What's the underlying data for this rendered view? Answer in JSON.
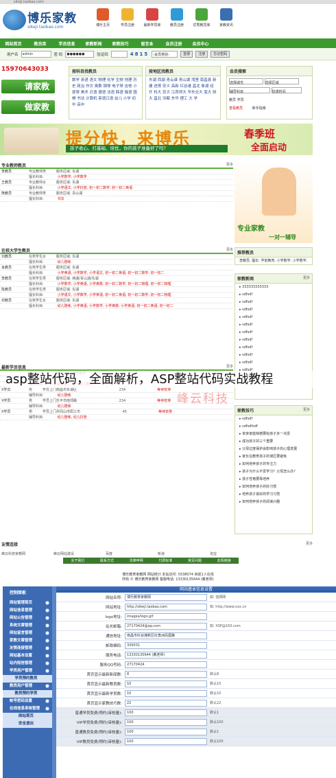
{
  "top_strip": "sikeji.taobao.com",
  "logo": {
    "name": "博乐家教",
    "url": "sikeji.taobao.com"
  },
  "top_nav": [
    {
      "label": "博乐主页",
      "color": "#e15a2a"
    },
    {
      "label": "学员注册",
      "color": "#f0b330"
    },
    {
      "label": "最新学员库",
      "color": "#d84444"
    },
    {
      "label": "教员注册",
      "color": "#2f9bd6"
    },
    {
      "label": "优秀教员库",
      "color": "#4aa63a"
    },
    {
      "label": "家教资讯",
      "color": "#3a6fb0"
    }
  ],
  "main_nav": [
    "网站首页",
    "教员库",
    "学员信息",
    "家教新闻",
    "家教技巧",
    "留言本",
    "会员注册",
    "会员中心"
  ],
  "login": {
    "user_label": "用户名",
    "user_value": "admin",
    "pwd_label": "密 码",
    "pwd_value": "●●●●●●",
    "code_label": "验证码",
    "code_value": "4815",
    "select_value": "-会员类别-",
    "login_btn": "登录",
    "reg_btn": "注册",
    "forgot_btn": "忘记密码"
  },
  "phone": "15970643033",
  "buttons": {
    "qing": "请家教",
    "zuo": "做家教"
  },
  "subject_box": {
    "title": "按科目找教员",
    "text": "数学 英语 语文 物理 化学 生物 地理 历史 政治 作文 奥数 钢琴 电子琴 吉他 小提琴 美术 日语 德语 法语 韩语 俄语 围棋 书法 计算机 英语口语 幼儿 小学 初中 高中"
  },
  "region_box": {
    "title": "按地区找教员",
    "text": "东湖 西湖 青云谱 青山湖 湾里 南昌县 新建 进贤 安义 高新 红谷滩 昌北 象湖 经开 科大 农大 江西师大 华东交大 南大 财大 昌北 洪都 东华 理工 大 学"
  },
  "member_box": {
    "title": "会员搜索",
    "sel1": "选择城市",
    "sel2": "选择区域",
    "sel3": "辅导科目",
    "sel4": "授课时间",
    "opt1": "教员",
    "opt2": "学员",
    "search_btn": "查看教员",
    "reg": "新手指南"
  },
  "banner": {
    "t1": "提分快，来博乐",
    "t2": "孩子收心、打基础、培优，你的孩子准备好了吗？",
    "t3": "春季班",
    "t4": "全面启动"
  },
  "sec1": {
    "title": "专业教师教员",
    "more": "更多",
    "rows": [
      {
        "a": "李教员",
        "b": "专业教师",
        "c": "男",
        "d": "服务区域: 东湖",
        "e": "",
        "red": false
      },
      {
        "a": "",
        "b": "擅长科目:",
        "c": "",
        "d": "",
        "e": "小学数学, 小学数学",
        "red": true
      },
      {
        "a": "王教员",
        "b": "专业教师",
        "c": "女",
        "d": "服务区域: 东湖",
        "e": "",
        "red": false
      },
      {
        "a": "",
        "b": "擅长科目:",
        "c": "",
        "d": "",
        "e": "小学语文, 小学托管, 初一初二数学, 初一初二英语",
        "red": true
      },
      {
        "a": "熊教员",
        "b": "专业教师",
        "c": "男",
        "d": "服务区域: 青山湖",
        "e": "",
        "red": false
      },
      {
        "a": "",
        "b": "擅长科目:",
        "c": "",
        "d": "",
        "e": "书法",
        "red": true
      }
    ]
  },
  "sec2": {
    "title": "在校大学生教员",
    "more": "更多",
    "rows": [
      {
        "a": "刘教员",
        "b": "在校学生",
        "c": "女",
        "d": "服务区域: 东湖",
        "e": "",
        "red": false
      },
      {
        "a": "",
        "b": "擅长科目:",
        "c": "",
        "d": "",
        "e": "幼儿陪练",
        "red": true
      },
      {
        "a": "肖教员",
        "b": "在校学生",
        "c": "男",
        "d": "服务区域: 东湖",
        "e": "",
        "red": false
      },
      {
        "a": "",
        "b": "擅长科目:",
        "c": "",
        "d": "",
        "e": "小学英语, 小学数学, 小学语文, 初一初二英语, 初一初二数学, 初一初二",
        "red": true
      },
      {
        "a": "李教员",
        "b": "在校学生",
        "c": "男",
        "d": "服务区域: 西湖/青山湖/东湖",
        "e": "",
        "red": false
      },
      {
        "a": "",
        "b": "擅长科目:",
        "c": "",
        "d": "",
        "e": "小学数学, 小学英语, 小学奥数, 初一初二数学, 初一初二物理, 初一初二物理",
        "red": true
      },
      {
        "a": "陈教员",
        "b": "在校学生",
        "c": "男",
        "d": "服务区域: 东湖",
        "e": "",
        "red": false
      },
      {
        "a": "",
        "b": "擅长科目:",
        "c": "",
        "d": "",
        "e": "小学语文, 小学数学, 小学英语, 初一初二英语, 初一初二数学, 初一初二物理",
        "red": true
      },
      {
        "a": "邓教员",
        "b": "在校学生",
        "c": "女",
        "d": "服务区域: 东湖",
        "e": "",
        "red": false
      },
      {
        "a": "",
        "b": "擅长科目:",
        "c": "",
        "d": "",
        "e": "幼儿陪练, 小学英语, 小学数学, 小学奥数, 小学英语, 初一初二英语, 初一初二",
        "red": true
      }
    ]
  },
  "sec3": {
    "title": "最新学员信息",
    "more": "更多",
    "rows": [
      {
        "a": "",
        "b": "",
        "c": "",
        "d": "辅导科目: 小学数学",
        "e": "",
        "red": true
      },
      {
        "a": "",
        "b": "南昌市南昌县",
        "c": "",
        "d": "",
        "e": "",
        "red": false
      },
      {
        "a": "",
        "b": "辅导科目:",
        "c": "",
        "d": "",
        "e": "初一初二 初一初二数学",
        "red": true
      },
      {
        "a": "X学员",
        "b": "男",
        "c": "学员上门",
        "d": "南昌市东湖区",
        "e": "234",
        "red": false
      },
      {
        "a": "",
        "b": "辅导科目:",
        "c": "",
        "d": "",
        "e": "幼儿陪练",
        "red": true
      },
      {
        "a": "X学员",
        "b": "男",
        "c": "学员上门",
        "d": "乐平市南郊路",
        "e": "234",
        "red": false
      },
      {
        "a": "",
        "b": "辅导科目:",
        "c": "",
        "d": "",
        "e": "幼儿陪练",
        "red": true
      },
      {
        "a": "X学员",
        "b": "男",
        "c": "学员上门",
        "d": "井冈山市阳工市",
        "e": "45",
        "red": false
      },
      {
        "a": "",
        "b": "辅导科目:",
        "c": "",
        "d": "",
        "e": "幼儿陪练, 幼儿托管",
        "red": true
      }
    ],
    "status": "等待安排"
  },
  "right_img": {
    "caption": "专业家教",
    "sub": "一对一辅导"
  },
  "recommend": {
    "title": "推荐教员",
    "text": "李教员, 擅长: 学前教育, 小学数学, 小学数学,"
  },
  "news": {
    "title": "家教新闻",
    "more": "更多",
    "items": [
      "333333333333",
      "sdfsdf",
      "sdfsdf",
      "sdfsdf",
      "sdfsdf",
      "sdfsdf",
      "sdfsdf",
      "sdfsdf",
      "sdfsdf",
      "sdfsdf",
      "sdfsdf",
      "sdfsdf"
    ]
  },
  "tips": {
    "title": "家教技巧",
    "more": "更多",
    "items": [
      "sdfsdf",
      "sdfsdfsdf",
      "单亲家庭缺憾要给孩子多一点爱",
      "成功孩子的三个重要",
      "父母过度保护会影响孩子的心理发展",
      "家长在教育孩子的误区要避免",
      "如何培养孩子的专注力",
      "孩子为什么不爱学习？父母怎么办？",
      "孩子性格要靠培养",
      "如何培养孩子的好习惯",
      "培养孩子良好的学习习惯",
      "如何培养孩子的阅读兴趣"
    ]
  },
  "overlay": "asp整站代码，全面解析，ASP整站代码实战教程",
  "watermark": "峰云科技",
  "links": {
    "title": "友情连接",
    "more": "更多",
    "items": [
      "峰云科技家教网",
      "峰云网站建设",
      "百度",
      "新浪",
      "淘宝"
    ]
  },
  "footer_nav": [
    "关于我们",
    "联系方式",
    "法律申明",
    "付费标准",
    "常见问题",
    "友情链接"
  ],
  "footer_info": [
    "博乐教育家教网  网站统计  本站访问: 0338074  目前1人在线",
    "所有 © 博乐教育家教网 客服电话: 13330135644 (戴老师)"
  ],
  "admin": {
    "sidebar_title": "控制面板",
    "menu": [
      {
        "label": "网站管理首页",
        "sub": false
      },
      {
        "label": "网站信息管理",
        "sub": false
      },
      {
        "label": "网站公告管理",
        "sub": false
      },
      {
        "label": "系统文章管理",
        "sub": false
      },
      {
        "label": "网站留言管理",
        "sub": false
      },
      {
        "label": "家教文章管理",
        "sub": false
      },
      {
        "label": "友情连接管理",
        "sub": false
      },
      {
        "label": "网站基本设置",
        "sub": false
      },
      {
        "label": "站内短信管理",
        "sub": false
      },
      {
        "label": "学员用户管理",
        "sub": false
      },
      {
        "label": "学员预约教员",
        "sub": true
      },
      {
        "label": "教员用户管理",
        "sub": false
      },
      {
        "label": "教员预约学员",
        "sub": true
      },
      {
        "label": "帐号密码设置",
        "sub": false
      },
      {
        "label": "在线信息审核管理",
        "sub": false
      },
      {
        "label": "网站首页",
        "sub": true
      },
      {
        "label": "安全退出",
        "sub": true
      }
    ],
    "title": "网站基本信息设置",
    "rows": [
      {
        "label": "网站名称:",
        "value": "博乐教育家教网",
        "hint": "如: 信网网"
      },
      {
        "label": "网站地址:",
        "value": "http://sikeji.taobao.com",
        "hint": "如: http://www.xxx.cn"
      },
      {
        "label": "logo地址:",
        "value": "images/logo.gif",
        "hint": ""
      },
      {
        "label": "站长邮箱:",
        "value": "27170424@qq.com",
        "hint": "如: XSP@163.com"
      },
      {
        "label": "通信地址:",
        "value": "南昌市红谷滩新区红角洲凤凰路",
        "hint": ""
      },
      {
        "label": "邮政编码:",
        "value": "330031",
        "hint": ""
      },
      {
        "label": "服务电话:",
        "value": "13330135644 (戴老师)",
        "hint": ""
      },
      {
        "label": "服务QQ号码:",
        "value": "27170424",
        "hint": ""
      },
      {
        "label": "首页显示最新新闻数:",
        "value": "8",
        "hint": "默认8"
      },
      {
        "label": "首页显示最新教员数:",
        "value": "10",
        "hint": "默认10"
      },
      {
        "label": "首页显示最新学员数:",
        "value": "10",
        "hint": "默认10"
      },
      {
        "label": "首页显示家教技巧数:",
        "value": "22",
        "hint": "默认22"
      },
      {
        "label": "普通学员免费/预约(审核量):",
        "value": "100",
        "hint": "默认1"
      },
      {
        "label": "VIP学员免费/预约(审核量):",
        "value": "100",
        "hint": "默认100"
      },
      {
        "label": "普通教员免费/预约(审核量):",
        "value": "100",
        "hint": "默认1"
      },
      {
        "label": "VIP教员免费/预约(审核量):",
        "value": "100",
        "hint": "默认100"
      }
    ]
  }
}
